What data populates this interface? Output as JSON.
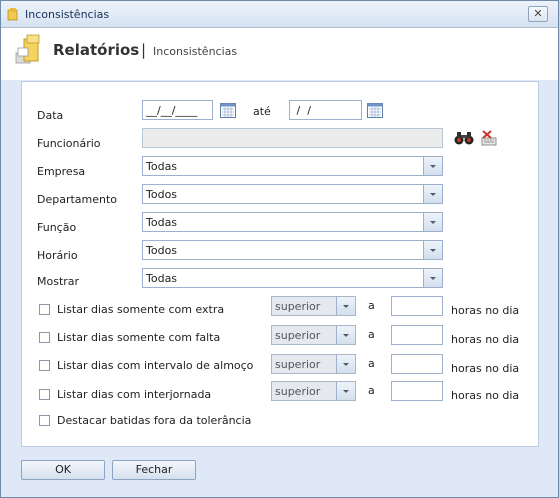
{
  "window": {
    "title": "Inconsistências",
    "close_glyph": "✕"
  },
  "header": {
    "title": "Relatórios",
    "separator": "|",
    "subtitle": "Inconsistências"
  },
  "form": {
    "data": {
      "label": "Data",
      "start_value": "__/__/____",
      "between": "até",
      "end_value": " /  /"
    },
    "funcionario": {
      "label": "Funcionário",
      "value": ""
    },
    "empresa": {
      "label": "Empresa",
      "value": "Todas"
    },
    "departamento": {
      "label": "Departamento",
      "value": "Todos"
    },
    "funcao": {
      "label": "Função",
      "value": "Todas"
    },
    "horario": {
      "label": "Horário",
      "value": "Todos"
    },
    "mostrar": {
      "label": "Mostrar",
      "value": "Todas"
    },
    "options": [
      {
        "label": "Listar dias somente com extra",
        "operator": "superior",
        "connector": "a",
        "hours": "",
        "unit": "horas no dia",
        "checked": false
      },
      {
        "label": "Listar dias somente com falta",
        "operator": "superior",
        "connector": "a",
        "hours": "",
        "unit": "horas no dia",
        "checked": false
      },
      {
        "label": "Listar dias com intervalo de almoço",
        "operator": "superior",
        "connector": "a",
        "hours": "",
        "unit": "horas no dia",
        "checked": false
      },
      {
        "label": "Listar dias com interjornada",
        "operator": "superior",
        "connector": "a",
        "hours": "",
        "unit": "horas no dia",
        "checked": false
      }
    ],
    "destacar": {
      "label": "Destacar batidas fora da tolerância",
      "checked": false
    }
  },
  "buttons": {
    "ok": "OK",
    "cancel": "Fechar"
  },
  "colors": {
    "accent": "#15325a",
    "window_bg": "#dfe8f6",
    "border": "#9db1cc"
  }
}
